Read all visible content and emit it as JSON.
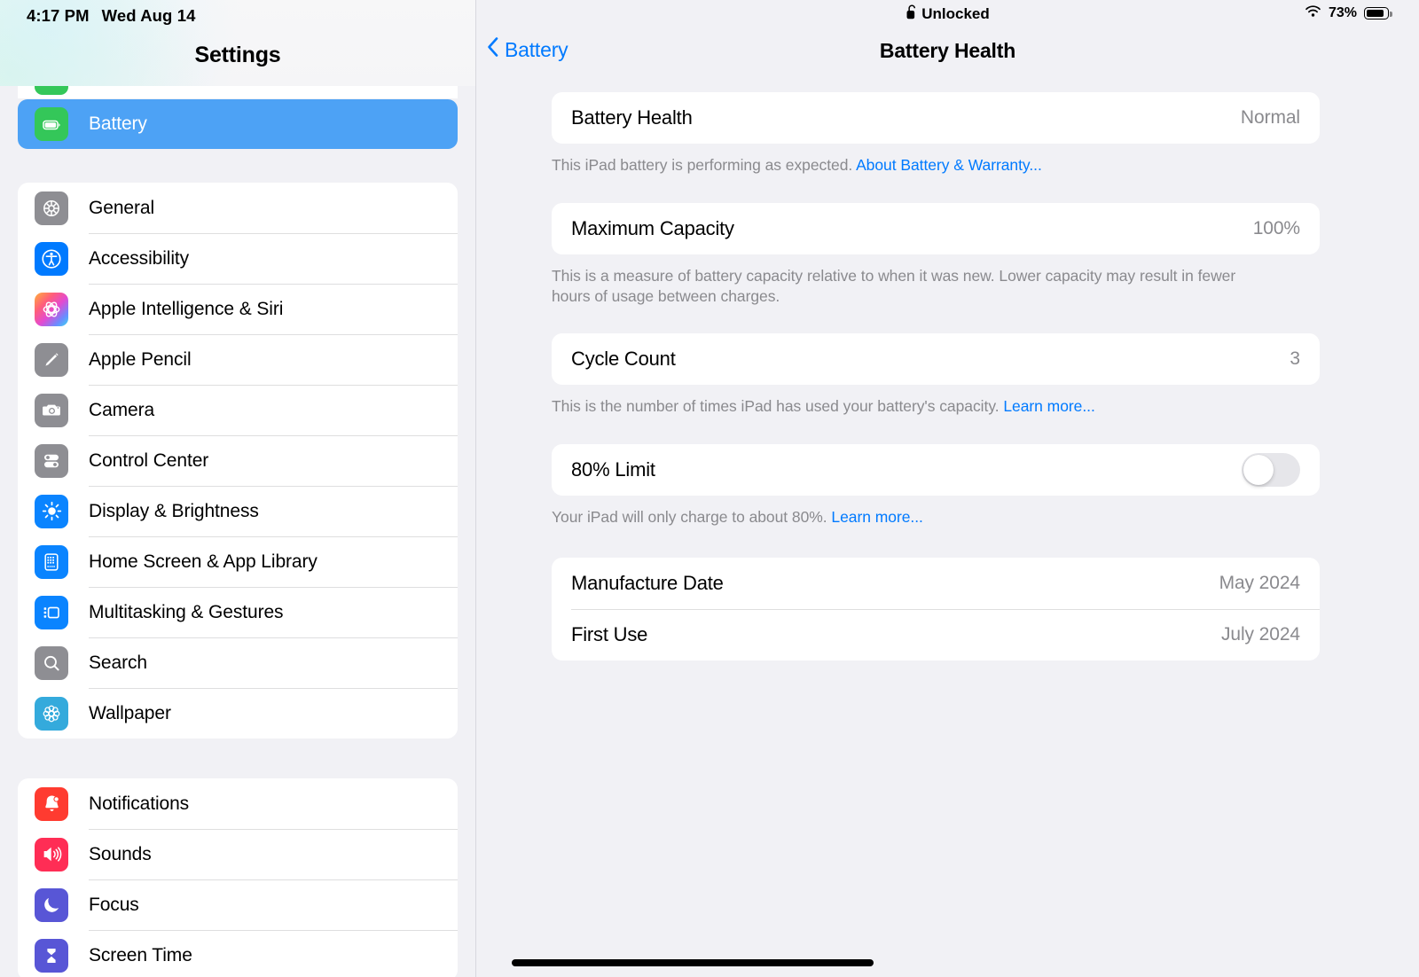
{
  "statusbar": {
    "time": "4:17 PM",
    "date": "Wed Aug 14",
    "lock_state": "Unlocked",
    "lock_icon": "unlocked-padlock-icon",
    "wifi_icon": "wifi-icon",
    "battery_percent": "73%",
    "battery_level": 73
  },
  "sidebar": {
    "title": "Settings",
    "selected": {
      "label": "Battery",
      "icon": "battery-icon"
    },
    "groups": [
      {
        "items": [
          {
            "label": "General",
            "icon": "gear-icon"
          },
          {
            "label": "Accessibility",
            "icon": "accessibility-icon"
          },
          {
            "label": "Apple Intelligence & Siri",
            "icon": "apple-intelligence-icon"
          },
          {
            "label": "Apple Pencil",
            "icon": "pencil-icon"
          },
          {
            "label": "Camera",
            "icon": "camera-icon"
          },
          {
            "label": "Control Center",
            "icon": "control-center-icon"
          },
          {
            "label": "Display & Brightness",
            "icon": "brightness-icon"
          },
          {
            "label": "Home Screen & App Library",
            "icon": "home-screen-icon"
          },
          {
            "label": "Multitasking & Gestures",
            "icon": "multitasking-icon"
          },
          {
            "label": "Search",
            "icon": "search-icon"
          },
          {
            "label": "Wallpaper",
            "icon": "wallpaper-icon"
          }
        ]
      },
      {
        "items": [
          {
            "label": "Notifications",
            "icon": "bell-icon"
          },
          {
            "label": "Sounds",
            "icon": "speaker-icon"
          },
          {
            "label": "Focus",
            "icon": "moon-icon"
          },
          {
            "label": "Screen Time",
            "icon": "hourglass-icon"
          }
        ]
      }
    ]
  },
  "detail": {
    "back_label": "Battery",
    "back_icon": "chevron-left-icon",
    "title": "Battery Health",
    "sections": [
      {
        "rows": [
          {
            "label": "Battery Health",
            "value": "Normal"
          }
        ],
        "footnote_text": "This iPad battery is performing as expected. ",
        "footnote_link": "About Battery & Warranty..."
      },
      {
        "rows": [
          {
            "label": "Maximum Capacity",
            "value": "100%"
          }
        ],
        "footnote_text": "This is a measure of battery capacity relative to when it was new. Lower capacity may result in fewer hours of usage between charges.",
        "footnote_link": ""
      },
      {
        "rows": [
          {
            "label": "Cycle Count",
            "value": "3"
          }
        ],
        "footnote_text": "This is the number of times iPad has used your battery's capacity. ",
        "footnote_link": "Learn more..."
      },
      {
        "rows": [
          {
            "label": "80% Limit",
            "value": "",
            "toggle": "off"
          }
        ],
        "footnote_text": "Your iPad will only charge to about 80%. ",
        "footnote_link": "Learn more..."
      },
      {
        "rows": [
          {
            "label": "Manufacture Date",
            "value": "May 2024"
          },
          {
            "label": "First Use",
            "value": "July 2024"
          }
        ],
        "footnote_text": "",
        "footnote_link": ""
      }
    ]
  },
  "colors": {
    "accent_blue": "#007aff",
    "selected_row": "#4da2f5",
    "page_bg": "#f1f1f5",
    "card_bg": "#ffffff",
    "secondary_text": "#8a8a8e"
  }
}
